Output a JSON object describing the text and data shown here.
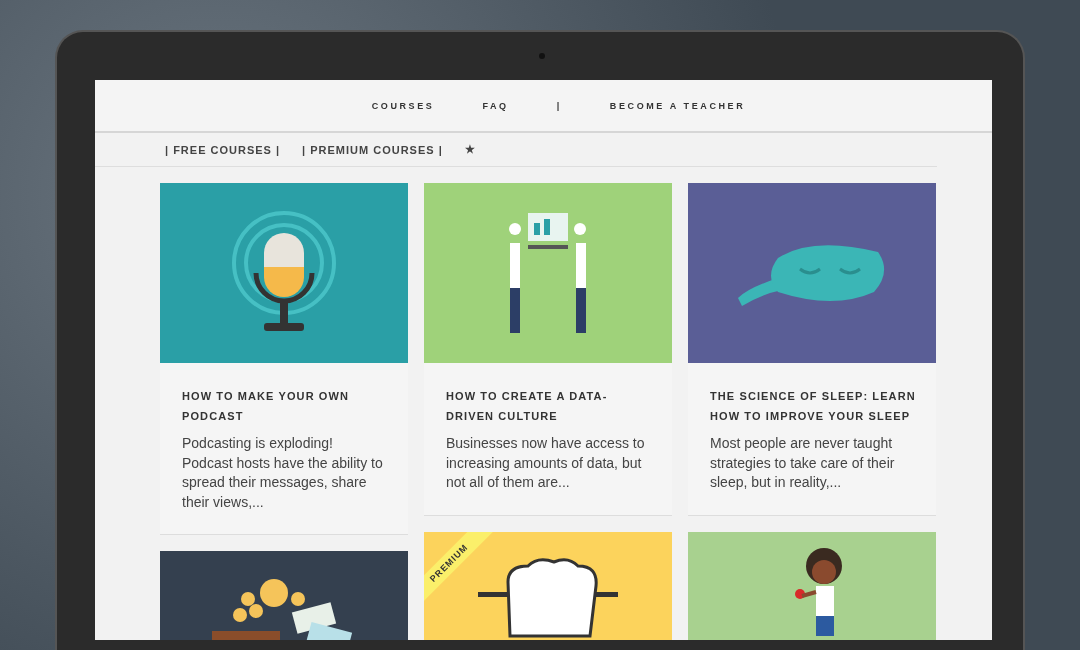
{
  "nav": {
    "links": [
      {
        "label": "COURSES"
      },
      {
        "label": "FAQ"
      },
      {
        "label": "|"
      },
      {
        "label": "BECOME A TEACHER"
      }
    ]
  },
  "subnav": {
    "links": [
      {
        "label": "| FREE COURSES |"
      },
      {
        "label": "| PREMIUM COURSES |"
      },
      {
        "label": "★"
      }
    ]
  },
  "columns": [
    {
      "courses": [
        {
          "kind": "podcast",
          "title": "HOW TO MAKE YOUR OWN PODCAST",
          "excerpt": "Podcasting is exploding! Podcast hosts have the ability to spread their messages, share their views,..."
        },
        {
          "kind": "money"
        }
      ]
    },
    {
      "courses": [
        {
          "kind": "data",
          "title": "HOW TO CREATE A DATA-DRIVEN CULTURE",
          "excerpt": "Businesses now have access to increasing amounts of data, but not all of them are..."
        },
        {
          "kind": "fist",
          "badge": "PREMIUM"
        }
      ]
    },
    {
      "courses": [
        {
          "kind": "sleep",
          "title": "THE SCIENCE OF SLEEP: LEARN HOW TO IMPROVE YOUR SLEEP",
          "excerpt": "Most people are never taught strategies to take care of their sleep, but in reality,..."
        },
        {
          "kind": "person"
        }
      ]
    }
  ]
}
